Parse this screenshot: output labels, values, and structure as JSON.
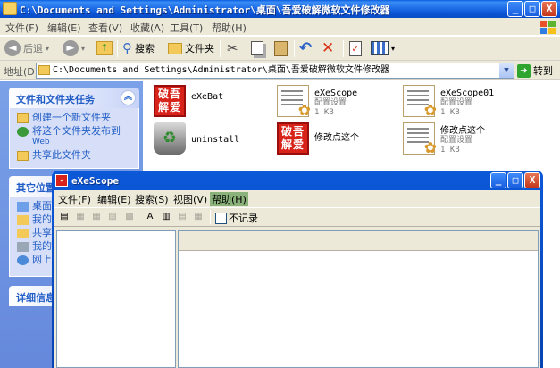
{
  "explorer": {
    "title": "C:\\Documents and Settings\\Administrator\\桌面\\吾爱破解微软文件修改器",
    "window_buttons": [
      "_",
      "□",
      "X"
    ],
    "menu": [
      "文件(F)",
      "编辑(E)",
      "查看(V)",
      "收藏(A)",
      "工具(T)",
      "帮助(H)"
    ],
    "toolbar": {
      "back": "后退",
      "search": "搜索",
      "folders": "文件夹"
    },
    "address": {
      "label": "地址(D)",
      "value": "C:\\Documents and Settings\\Administrator\\桌面\\吾爱破解微软文件修改器",
      "go": "转到"
    },
    "taskpane": {
      "file_tasks": {
        "title": "文件和文件夹任务",
        "items": [
          {
            "label": "创建一个新文件夹",
            "sub": ""
          },
          {
            "label": "将这个文件夹发布到",
            "sub": "Web"
          },
          {
            "label": "共享此文件夹",
            "sub": ""
          }
        ]
      },
      "other_places": {
        "title": "其它位置",
        "items": [
          "桌面",
          "我的",
          "共享",
          "我的",
          "网上"
        ]
      },
      "details": {
        "title": "详细信息"
      }
    },
    "files": [
      {
        "name": "eXeBat",
        "sub1": "",
        "sub2": "",
        "icon": "wuai-icon"
      },
      {
        "name": "eXeScope",
        "sub1": "配置设置",
        "sub2": "1 KB",
        "icon": "config-file-icon"
      },
      {
        "name": "eXeScope01",
        "sub1": "配置设置",
        "sub2": "1 KB",
        "icon": "config-file-icon"
      },
      {
        "name": "uninstall",
        "sub1": "",
        "sub2": "",
        "icon": "recycle-bin-icon"
      },
      {
        "name": "修改点这个",
        "sub1": "",
        "sub2": "",
        "icon": "wuai-icon"
      },
      {
        "name": "修改点这个",
        "sub1": "配置设置",
        "sub2": "1 KB",
        "icon": "config-file-icon"
      }
    ],
    "wuai_icon_text": "破吾解爱"
  },
  "exescope": {
    "title": "eXeScope",
    "menu": [
      "文件(F)",
      "编辑(E)",
      "搜索(S)",
      "视图(V)",
      "帮助(H)"
    ],
    "no_log_label": "不记录"
  },
  "colors": {
    "xp_blue": "#0b54d4",
    "taskpane_blue": "#6f94e2",
    "panel_link": "#215dc6",
    "wuai_red": "#d8231b"
  }
}
